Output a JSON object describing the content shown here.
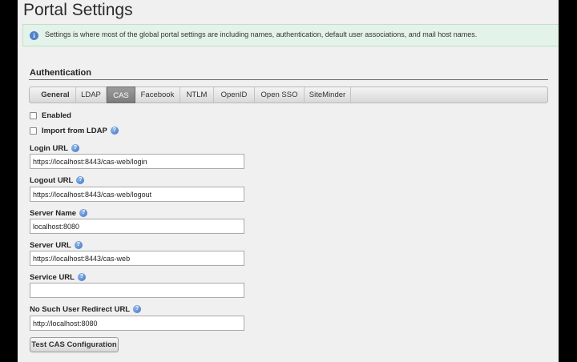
{
  "page": {
    "title": "Portal Settings"
  },
  "info": {
    "text": "Settings is where most of the global portal settings are including names, authentication, default user associations, and mail host names."
  },
  "section": {
    "title": "Authentication"
  },
  "tabs": [
    {
      "label": "General"
    },
    {
      "label": "LDAP"
    },
    {
      "label": "CAS"
    },
    {
      "label": "Facebook"
    },
    {
      "label": "NTLM"
    },
    {
      "label": "OpenID"
    },
    {
      "label": "Open SSO"
    },
    {
      "label": "SiteMinder"
    }
  ],
  "active_tab": "CAS",
  "checkboxes": {
    "enabled": {
      "label": "Enabled",
      "checked": false
    },
    "import_ldap": {
      "label": "Import from LDAP",
      "checked": false
    }
  },
  "fields": {
    "login_url": {
      "label": "Login URL",
      "value": "https://localhost:8443/cas-web/login"
    },
    "logout_url": {
      "label": "Logout URL",
      "value": "https://localhost:8443/cas-web/logout"
    },
    "server_name": {
      "label": "Server Name",
      "value": "localhost:8080"
    },
    "server_url": {
      "label": "Server URL",
      "value": "https://localhost:8443/cas-web"
    },
    "service_url": {
      "label": "Service URL",
      "value": ""
    },
    "no_such_user_url": {
      "label": "No Such User Redirect URL",
      "value": "http://localhost:8080"
    }
  },
  "button": {
    "test_cas": "Test CAS Configuration"
  },
  "icons": {
    "info": "info-icon",
    "help": "help-icon"
  },
  "colors": {
    "info_bg": "#e4f3ea",
    "active_tab": "#8a8a8a",
    "help_icon": "#3d70c2"
  }
}
